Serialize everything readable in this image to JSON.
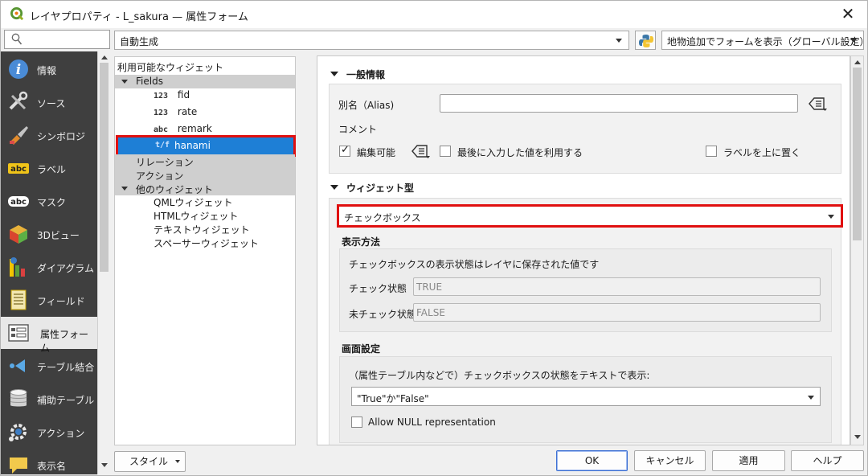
{
  "window": {
    "title": "レイヤプロパティ - L_sakura — 属性フォーム",
    "close_label": "✕"
  },
  "topbar": {
    "generator_select": "自動生成",
    "feature_display_select": "地物追加でフォームを表示（グローバル設定）"
  },
  "sidebar": {
    "items": [
      {
        "label": "情報",
        "icon": "info-icon"
      },
      {
        "label": "ソース",
        "icon": "source-tools-icon"
      },
      {
        "label": "シンボロジ",
        "icon": "symbology-brush-icon"
      },
      {
        "label": "ラベル",
        "icon": "labels-abc-icon"
      },
      {
        "label": "マスク",
        "icon": "mask-abc-icon"
      },
      {
        "label": "3Dビュー",
        "icon": "3d-cube-icon"
      },
      {
        "label": "ダイアグラム",
        "icon": "diagram-icon"
      },
      {
        "label": "フィールド",
        "icon": "fields-icon"
      },
      {
        "label": "属性フォーム",
        "icon": "attribute-form-icon"
      },
      {
        "label": "テーブル結合",
        "icon": "joins-icon"
      },
      {
        "label": "補助テーブル",
        "icon": "auxiliary-storage-icon"
      },
      {
        "label": "アクション",
        "icon": "actions-gear-icon"
      },
      {
        "label": "表示名",
        "icon": "display-bubble-icon"
      }
    ],
    "active_index": 8
  },
  "tree": {
    "header": "利用可能なウィジェット",
    "fields_group": "Fields",
    "fields": [
      {
        "type": "123",
        "name": "fid"
      },
      {
        "type": "123",
        "name": "rate"
      },
      {
        "type": "abc",
        "name": "remark"
      },
      {
        "type": "t/f",
        "name": "hanami"
      }
    ],
    "relations_group": "リレーション",
    "actions_group": "アクション",
    "other_group": "他のウィジェット",
    "other_widgets": [
      "QMLウィジェット",
      "HTMLウィジェット",
      "テキストウィジェット",
      "スペーサーウィジェット"
    ]
  },
  "general": {
    "title": "一般情報",
    "alias_label": "別名（Alias)",
    "alias_value": "",
    "comment_label": "コメント",
    "editable_label": "編集可能",
    "editable_checked": true,
    "reuse_last_label": "最後に入力した値を利用する",
    "reuse_last_checked": false,
    "label_on_top_label": "ラベルを上に置く",
    "label_on_top_checked": false
  },
  "widget_type": {
    "title": "ウィジェット型",
    "selected": "チェックボックス",
    "representation_title": "表示方法",
    "representation_desc": "チェックボックスの表示状態はレイヤに保存された値です",
    "checked_label": "チェック状態",
    "checked_value": "TRUE",
    "unchecked_label": "未チェック状態",
    "unchecked_value": "FALSE"
  },
  "display": {
    "title": "画面設定",
    "desc": "（属性テーブル内などで）チェックボックスの状態をテキストで表示:",
    "text_mode": "\"True\"か\"False\"",
    "allow_null_label": "Allow NULL representation",
    "allow_null_checked": false
  },
  "footer": {
    "style": "スタイル",
    "ok": "OK",
    "cancel": "キャンセル",
    "apply": "適用",
    "help": "ヘルプ"
  },
  "colors": {
    "selection": "#1e7fd6",
    "highlight_box": "#e01010",
    "sidebar_bg": "#3f3f3f"
  }
}
